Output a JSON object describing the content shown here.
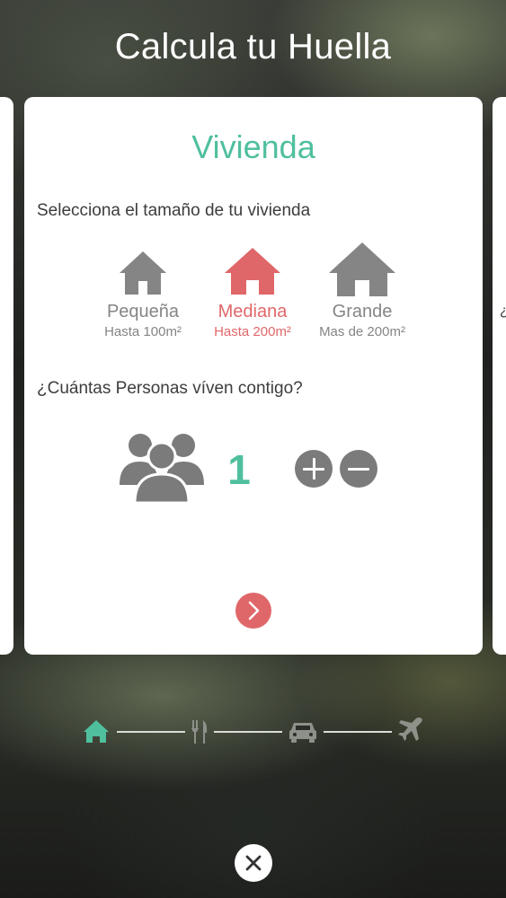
{
  "header": {
    "title": "Calcula tu Huella"
  },
  "card": {
    "title": "Vivienda",
    "size_question": "Selecciona el tamaño de tu vivienda",
    "size_options": [
      {
        "label": "Pequeña",
        "detail": "Hasta 100m²",
        "selected": false
      },
      {
        "label": "Mediana",
        "detail": "Hasta 200m²",
        "selected": true
      },
      {
        "label": "Grande",
        "detail": "Mas de 200m²",
        "selected": false
      }
    ],
    "people_question": "¿Cuántas Personas víven contigo?",
    "people_count": "1"
  },
  "next_peek_text": "¿",
  "progress_steps": [
    {
      "name": "home-icon",
      "active": true
    },
    {
      "name": "fork-knife-icon",
      "active": false
    },
    {
      "name": "car-icon",
      "active": false
    },
    {
      "name": "airplane-icon",
      "active": false
    }
  ],
  "colors": {
    "accent_green": "#4fbf9e",
    "selected_red": "#e06769",
    "icon_gray": "#7b7b7b"
  }
}
